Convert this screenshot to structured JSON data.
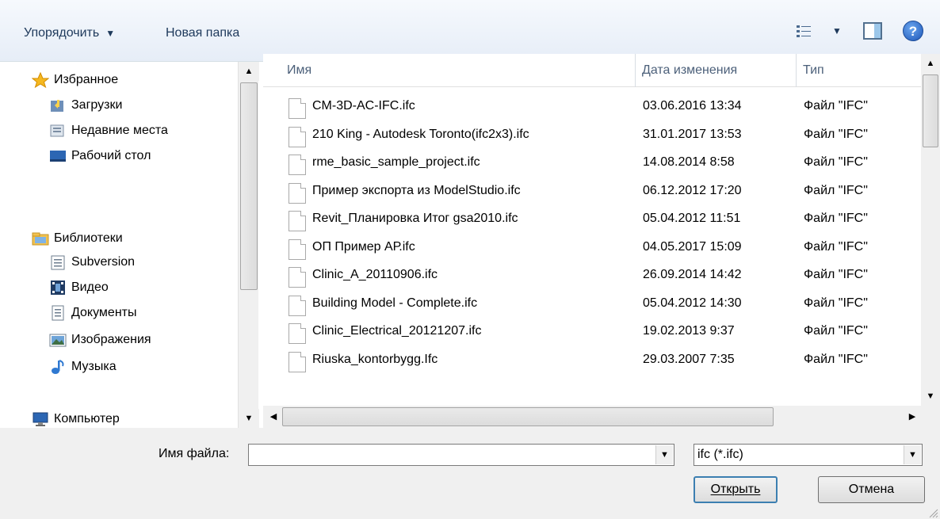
{
  "toolbar": {
    "organize_label": "Упорядочить",
    "new_folder_label": "Новая папка"
  },
  "nav": {
    "favorites_label": "Избранное",
    "downloads_label": "Загрузки",
    "recent_label": "Недавние места",
    "desktop_label": "Рабочий стол",
    "libraries_label": "Библиотеки",
    "subversion_label": "Subversion",
    "video_label": "Видео",
    "documents_label": "Документы",
    "images_label": "Изображения",
    "music_label": "Музыка",
    "computer_label": "Компьютер"
  },
  "columns": {
    "name": "Имя",
    "date": "Дата изменения",
    "type": "Тип"
  },
  "files": [
    {
      "name": "CM-3D-AC-IFC.ifc",
      "date": "03.06.2016 13:34",
      "type": "Файл \"IFC\""
    },
    {
      "name": "210 King - Autodesk Toronto(ifc2x3).ifc",
      "date": "31.01.2017 13:53",
      "type": "Файл \"IFC\""
    },
    {
      "name": "rme_basic_sample_project.ifc",
      "date": "14.08.2014 8:58",
      "type": "Файл \"IFC\""
    },
    {
      "name": "Пример экспорта из ModelStudio.ifc",
      "date": "06.12.2012 17:20",
      "type": "Файл \"IFC\""
    },
    {
      "name": "Revit_Планировка Итог gsa2010.ifc",
      "date": "05.04.2012 11:51",
      "type": "Файл \"IFC\""
    },
    {
      "name": "ОП Пример АР.ifc",
      "date": "04.05.2017 15:09",
      "type": "Файл \"IFC\""
    },
    {
      "name": "Clinic_A_20110906.ifc",
      "date": "26.09.2014 14:42",
      "type": "Файл \"IFC\""
    },
    {
      "name": "Building Model - Complete.ifc",
      "date": "05.04.2012 14:30",
      "type": "Файл \"IFC\""
    },
    {
      "name": "Clinic_Electrical_20121207.ifc",
      "date": "19.02.2013 9:37",
      "type": "Файл \"IFC\""
    },
    {
      "name": "Riuska_kontorbygg.Ifc",
      "date": "29.03.2007 7:35",
      "type": "Файл \"IFC\""
    }
  ],
  "bottom": {
    "filename_label": "Имя файла:",
    "filename_value": "",
    "filetype_value": "ifc (*.ifc)",
    "open_label": "Открыть",
    "cancel_label": "Отмена"
  }
}
